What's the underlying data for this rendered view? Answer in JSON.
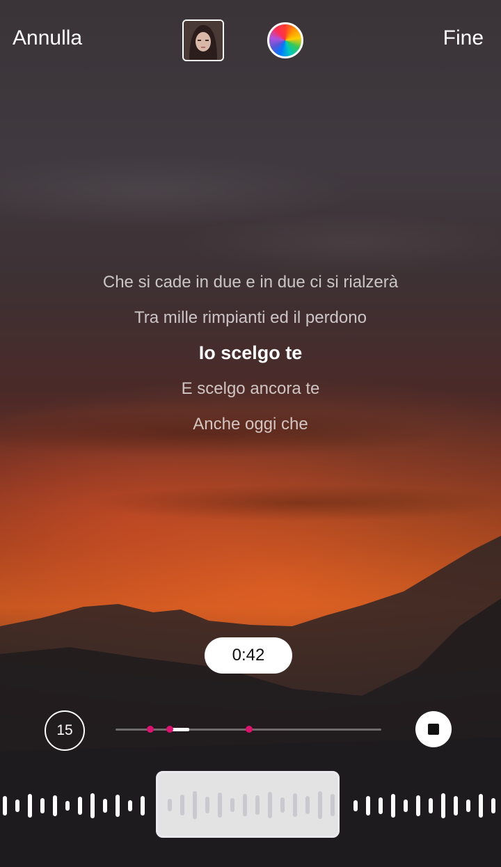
{
  "topbar": {
    "cancel_label": "Annulla",
    "done_label": "Fine",
    "album_icon": "album-cover",
    "color_icon": "color-wheel-icon"
  },
  "lyrics": {
    "lines": [
      "Che si cade in due e in due ci si rialzerà",
      "Tra mille rimpianti ed il perdono",
      "Io scelgo te",
      "E scelgo ancora te",
      "Anche oggi che"
    ],
    "current_index": 2
  },
  "playback": {
    "time": "0:42",
    "skip_label": "15",
    "progress_fraction": 0.26
  },
  "colors": {
    "accent": "#e0106f",
    "pill": "#ffffff"
  }
}
